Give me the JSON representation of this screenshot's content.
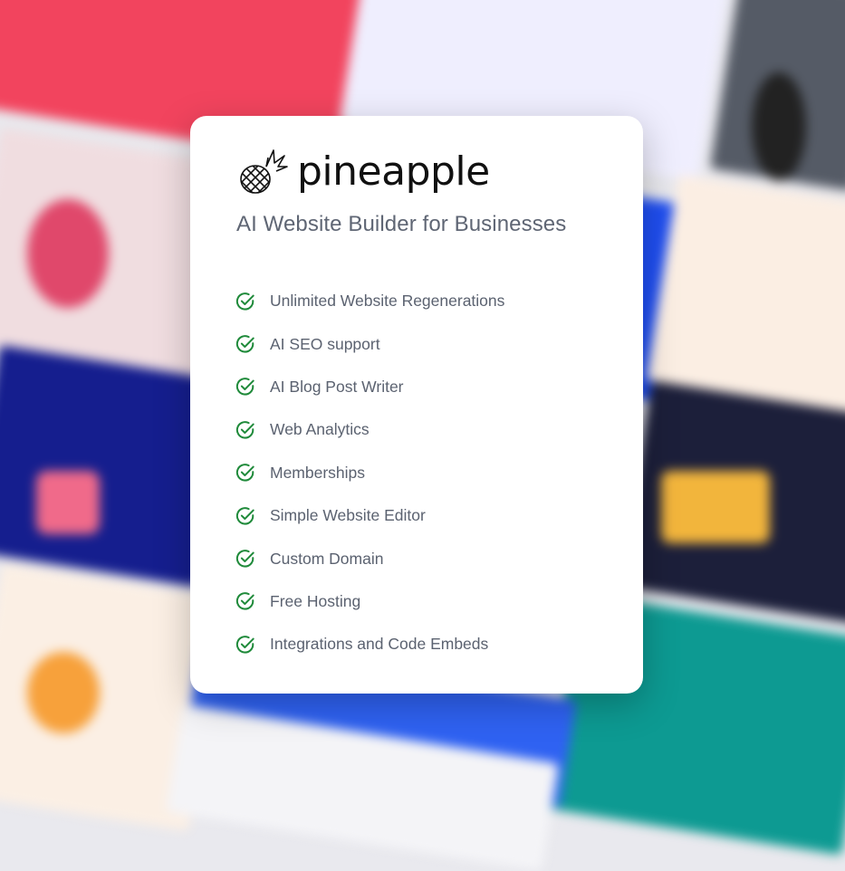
{
  "card": {
    "brand_name": "pineapple",
    "subtitle": "AI Website Builder for Businesses",
    "logo_icon": "pineapple-icon",
    "check_icon": "check-circle-icon",
    "accent_color": "#1f8a3a",
    "features": [
      {
        "label": "Unlimited Website Regenerations"
      },
      {
        "label": "AI SEO support"
      },
      {
        "label": "AI Blog Post Writer"
      },
      {
        "label": "Web Analytics"
      },
      {
        "label": "Memberships"
      },
      {
        "label": "Simple Website Editor"
      },
      {
        "label": "Custom Domain"
      },
      {
        "label": "Free Hosting"
      },
      {
        "label": "Integrations and Code Embeds"
      }
    ]
  }
}
